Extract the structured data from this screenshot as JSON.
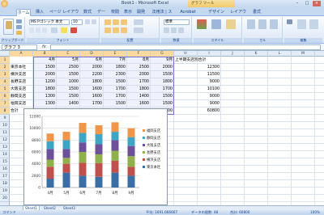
{
  "window": {
    "title": "Book1 - Microsoft Excel",
    "context_tool": "グラフ ツール"
  },
  "tabs": [
    "ホーム",
    "挿入",
    "ページ レイアウト",
    "数式",
    "データ",
    "校閲",
    "表示",
    "開発",
    "法用法 | ス",
    "Acrobat",
    "デザイン",
    "レイアウト",
    "書式"
  ],
  "ribbon": {
    "clipboard_label": "クリップボード",
    "font_label": "フォント",
    "align_label": "配置",
    "number_label": "数値",
    "style_label": "スタイル",
    "cells_label": "セル",
    "edit_label": "編集",
    "font_name": "MS Pゴシック 本文",
    "font_size": "10",
    "number_format": "標準",
    "paste": "貼り付け",
    "cond_format": "条件付き書式",
    "table_format": "テーブルとして書式設定",
    "cell_style": "セルのスタイル",
    "insert": "挿入",
    "delete": "削除",
    "format": "書式",
    "sort": "並べ替えとフィルタ",
    "find": "検索と選択"
  },
  "formula_bar": {
    "name_box": "グラフ 3",
    "fx": "fx",
    "formula": ""
  },
  "columns": [
    "A",
    "B",
    "C",
    "D",
    "E",
    "F",
    "G",
    "H",
    "I",
    "J",
    "K",
    "L",
    "M"
  ],
  "selected_columns": [
    "A",
    "B",
    "C",
    "D",
    "E",
    "F",
    "G"
  ],
  "rows": [
    "1",
    "2",
    "3",
    "4",
    "5",
    "6",
    "7",
    "8",
    "9",
    "10",
    "11",
    "12",
    "13",
    "14",
    "15",
    "16",
    "17",
    "18",
    "19",
    "20"
  ],
  "selected_rows": [
    "1",
    "2",
    "3",
    "4",
    "5",
    "6",
    "7",
    "8"
  ],
  "sheet": {
    "header": [
      "",
      "4月",
      "5月",
      "6月",
      "7月",
      "8月",
      "9月"
    ],
    "total_header": "上半期支店別合計",
    "rows": [
      {
        "name": "東京本社",
        "v": [
          "1500",
          "2500",
          "2000",
          "1800",
          "2500",
          "2000"
        ],
        "total": "12300"
      },
      {
        "name": "横浜支店",
        "v": [
          "2000",
          "1500",
          "2200",
          "2300",
          "2000",
          "1500"
        ],
        "total": "11500"
      },
      {
        "name": "長野支店",
        "v": [
          "1200",
          "1000",
          "1800",
          "1500",
          "1700",
          "1800"
        ],
        "total": "9000"
      },
      {
        "name": "大阪支店",
        "v": [
          "1800",
          "1500",
          "1600",
          "1700",
          "1800",
          "1700"
        ],
        "total": "10100"
      },
      {
        "name": "静岡支店",
        "v": [
          "1300",
          "1500",
          "1600",
          "1700",
          "1400",
          "1500"
        ],
        "total": "9000"
      },
      {
        "name": "福岡支店",
        "v": [
          "1300",
          "1400",
          "1700",
          "1500",
          "1600",
          "1500"
        ],
        "total": "9000"
      }
    ],
    "sum": {
      "name": "合計",
      "v": [
        "9100",
        "9400",
        "10900",
        "10500",
        "11000",
        "10000"
      ],
      "total": "60800"
    }
  },
  "chart_data": {
    "type": "bar",
    "stacked": true,
    "categories": [
      "4月",
      "5月",
      "6月",
      "7月",
      "8月",
      "9月"
    ],
    "series": [
      {
        "name": "東京本社",
        "color": "#3a6ea5",
        "values": [
          1500,
          2500,
          2000,
          1800,
          2500,
          2000
        ]
      },
      {
        "name": "横浜支店",
        "color": "#c0504d",
        "values": [
          2000,
          1500,
          2200,
          2300,
          2000,
          1500
        ]
      },
      {
        "name": "長野支店",
        "color": "#8fb04a",
        "values": [
          1200,
          1000,
          1800,
          1500,
          1700,
          1800
        ]
      },
      {
        "name": "大阪支店",
        "color": "#6e4f9a",
        "values": [
          1800,
          1500,
          1600,
          1700,
          1800,
          1700
        ]
      },
      {
        "name": "静岡支店",
        "color": "#3fa5c4",
        "values": [
          1300,
          1500,
          1600,
          1700,
          1400,
          1500
        ]
      },
      {
        "name": "福岡支店",
        "color": "#f0954a",
        "values": [
          1300,
          1400,
          1700,
          1500,
          1600,
          1500
        ]
      }
    ],
    "ylim": [
      0,
      12000
    ],
    "yticks": [
      "0",
      "2000",
      "4000",
      "6000",
      "8000",
      "10000",
      "12000"
    ],
    "grid": true,
    "legend": "right",
    "legend_order": [
      "福岡支店",
      "静岡支店",
      "大阪支店",
      "長野支店",
      "横浜支店",
      "東京本社"
    ]
  },
  "sheet_tabs": [
    "Sheet1",
    "Sheet2",
    "Sheet3"
  ],
  "status": {
    "mode": "コマンド",
    "average": "平均: 1691.666667",
    "count": "データの個数: 48",
    "sum": "合計: 60800",
    "zoom": "100%"
  }
}
